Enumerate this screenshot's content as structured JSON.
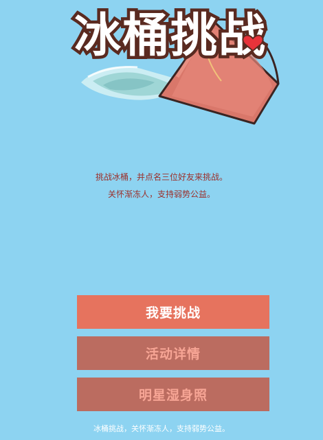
{
  "hero": {
    "title": "冰桶挑战",
    "image": "ice-bucket-illustration"
  },
  "intro": {
    "line1": "挑战冰桶，并点名三位好友来挑战。",
    "line2": "关怀渐冻人，支持弱势公益。"
  },
  "buttons": {
    "challenge": "我要挑战",
    "details": "活动详情",
    "celebrity_photos": "明星湿身照"
  },
  "footer": {
    "text": "冰桶挑战，关怀渐冻人，支持弱势公益。"
  },
  "colors": {
    "background": "#8dd3f1",
    "primary_button": "#e6735e",
    "secondary_button": "#bb6c60",
    "secondary_text": "#f7a595",
    "accent_text": "#9c2f2a"
  }
}
